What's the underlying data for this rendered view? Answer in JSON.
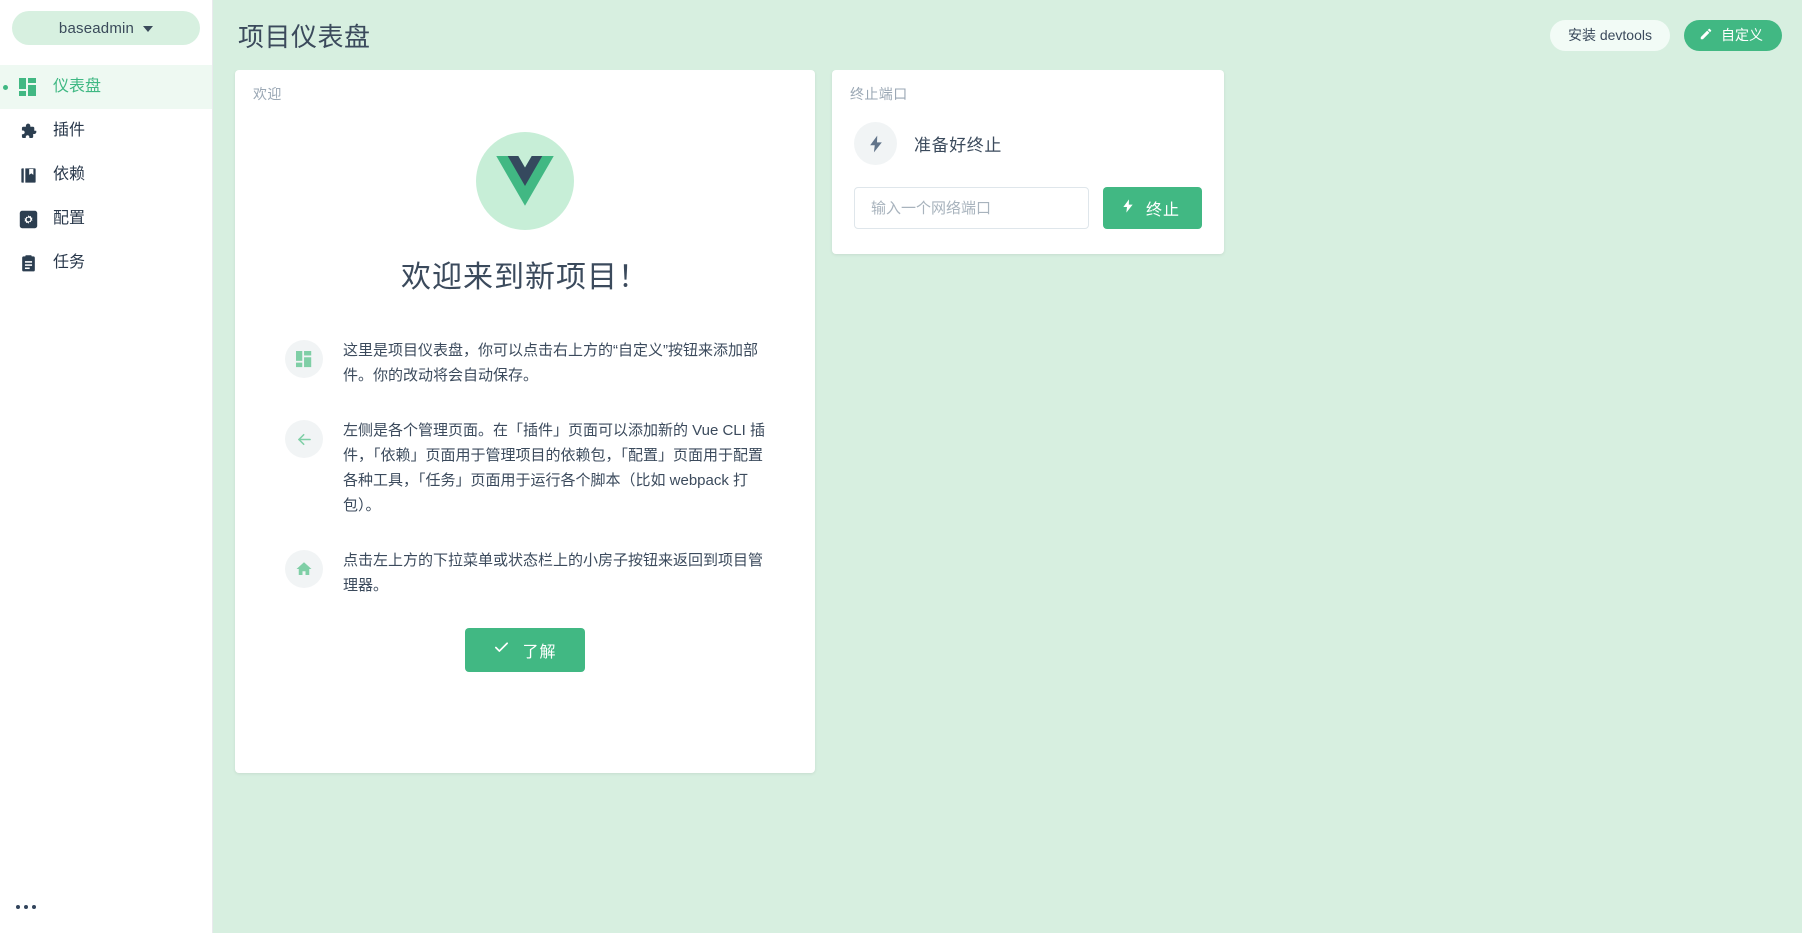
{
  "sidebar": {
    "project_switcher": {
      "label": "baseadmin",
      "caret": "chevron-down-icon"
    },
    "items": [
      {
        "label": "仪表盘",
        "icon": "dashboard-icon",
        "active": true
      },
      {
        "label": "插件",
        "icon": "puzzle-icon",
        "active": false
      },
      {
        "label": "依赖",
        "icon": "book-icon",
        "active": false
      },
      {
        "label": "配置",
        "icon": "gear-icon",
        "active": false
      },
      {
        "label": "任务",
        "icon": "clipboard-icon",
        "active": false
      }
    ],
    "more_button": "more-dots-icon"
  },
  "header": {
    "title": "项目仪表盘",
    "install_devtools_label": "安装 devtools",
    "customize_label": "自定义",
    "customize_icon": "pencil-icon"
  },
  "welcome_card": {
    "title": "欢迎",
    "logo": "vue-logo",
    "heading": "欢迎来到新项目！",
    "tips": [
      {
        "icon": "dashboard-icon",
        "text": "这里是项目仪表盘，你可以点击右上方的“自定义”按钮来添加部件。你的改动将会自动保存。"
      },
      {
        "icon": "arrow-left-icon",
        "text": "左侧是各个管理页面。在「插件」页面可以添加新的 Vue CLI 插件，「依赖」页面用于管理项目的依赖包，「配置」页面用于配置各种工具，「任务」页面用于运行各个脚本（比如 webpack 打包）。"
      },
      {
        "icon": "home-icon",
        "text": "点击左上方的下拉菜单或状态栏上的小房子按钮来返回到项目管理器。"
      }
    ],
    "understood_label": "了解",
    "understood_icon": "check-icon"
  },
  "terminate_card": {
    "title": "终止端口",
    "status_icon": "lightning-icon",
    "status_text": "准备好终止",
    "input_placeholder": "输入一个网络端口",
    "input_value": "",
    "button_label": "终止",
    "button_icon": "lightning-icon"
  },
  "colors": {
    "accent": "#41b883",
    "header_bg": "#d7efe0",
    "sidebar_active_bg": "#eef9f2",
    "text_dark": "#3b4a5c",
    "vue_logo_green": "#41b883",
    "vue_logo_navy": "#35495e"
  }
}
